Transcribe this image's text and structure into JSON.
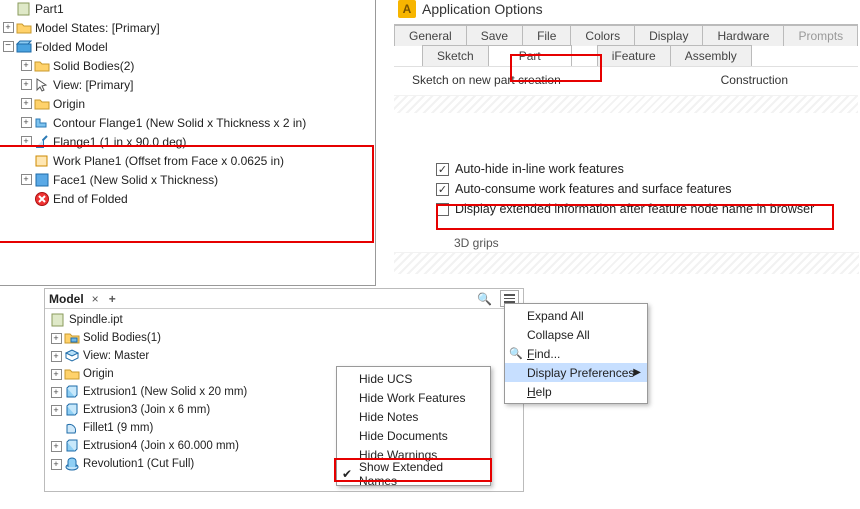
{
  "tree1": {
    "part": "Part1",
    "modelStates": "Model States: [Primary]",
    "folded": "Folded Model",
    "solidBodies": "Solid Bodies(2)",
    "view": "View: [Primary]",
    "origin": "Origin",
    "contourFlange": "Contour Flange1 (New Solid x Thickness x 2 in)",
    "flange": "Flange1 (1 in x 90.0 deg)",
    "workPlane": "Work Plane1 (Offset from Face x 0.0625 in)",
    "face": "Face1 (New Solid  x Thickness)",
    "endFolded": "End of Folded"
  },
  "appOptions": {
    "title": "Application Options",
    "tabsRow1": {
      "general": "General",
      "save": "Save",
      "file": "File",
      "colors": "Colors",
      "display": "Display",
      "hardware": "Hardware",
      "prompts": "Prompts"
    },
    "tabsRow2": {
      "sketch": "Sketch",
      "part": "Part",
      "ifeature": "iFeature",
      "assembly": "Assembly"
    },
    "lineLeft": "Sketch on new part creation",
    "lineRight": "Construction",
    "chk1": "Auto-hide in-line work features",
    "chk2": "Auto-consume work features and surface features",
    "chk3": "Display extended information after feature node name in browser",
    "threeD": "3D grips"
  },
  "bottom": {
    "panelTitle": "Model",
    "close": "×",
    "plus": "+",
    "spindle": "Spindle.ipt",
    "solidBodies": "Solid Bodies(1)",
    "viewMaster": "View: Master",
    "origin": "Origin",
    "ext1": "Extrusion1 (New Solid x 20 mm)",
    "ext3": "Extrusion3 (Join x 6 mm)",
    "fillet": "Fillet1 (9 mm)",
    "ext4": "Extrusion4 (Join x 60.000 mm)",
    "rev": "Revolution1 (Cut Full)"
  },
  "menu1": {
    "hideUCS": "Hide UCS",
    "hideWF": "Hide Work Features",
    "hideNotes": "Hide Notes",
    "hideDocs": "Hide Documents",
    "hideWarn": "Hide Warnings",
    "showExt": "Show Extended Names"
  },
  "menu2": {
    "expand": "Expand All",
    "collapse": "Collapse All",
    "find": "Find...",
    "findLetter": "F",
    "dispPref": "Display Preferences",
    "help": "Help",
    "helpLetter": "H"
  }
}
